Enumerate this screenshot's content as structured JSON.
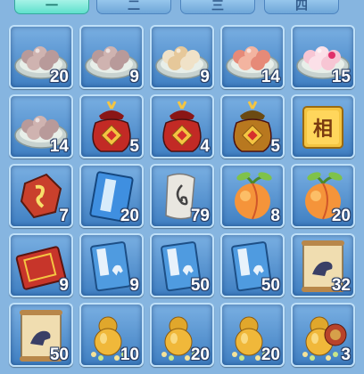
{
  "tabs": [
    {
      "label": "一",
      "active": true
    },
    {
      "label": "二",
      "active": false
    },
    {
      "label": "三",
      "active": false
    },
    {
      "label": "四",
      "active": false
    }
  ],
  "items": [
    {
      "icon": "grey-tangyuan-plate-icon",
      "count": "20"
    },
    {
      "icon": "grey-tangyuan-plate-icon",
      "count": "9"
    },
    {
      "icon": "sesame-tangyuan-plate-icon",
      "count": "9"
    },
    {
      "icon": "pink-tangyuan-plate-icon",
      "count": "14"
    },
    {
      "icon": "flower-tangyuan-plate-icon",
      "count": "15"
    },
    {
      "icon": "grey-tangyuan-plate-icon",
      "count": "14"
    },
    {
      "icon": "red-lucky-bag-icon",
      "count": "5"
    },
    {
      "icon": "red-lucky-bag-icon",
      "count": "4"
    },
    {
      "icon": "gold-lucky-bag-icon",
      "count": "5"
    },
    {
      "icon": "xiang-yellow-token-icon",
      "count": "",
      "glyph": "相"
    },
    {
      "icon": "red-rune-stone-icon",
      "count": "7"
    },
    {
      "icon": "blue-book-icon",
      "count": "20"
    },
    {
      "icon": "white-scroll-icon",
      "count": "79"
    },
    {
      "icon": "peach-icon",
      "count": "8"
    },
    {
      "icon": "peach-icon",
      "count": "20"
    },
    {
      "icon": "red-tome-icon",
      "count": "9"
    },
    {
      "icon": "blue-horse-manual-icon",
      "count": "9"
    },
    {
      "icon": "blue-horse-manual-icon",
      "count": "50"
    },
    {
      "icon": "blue-horse-manual-icon",
      "count": "50"
    },
    {
      "icon": "horse-scroll-icon",
      "count": "32"
    },
    {
      "icon": "horse-scroll-icon",
      "count": "50"
    },
    {
      "icon": "gold-gourd-coins-icon",
      "count": "10"
    },
    {
      "icon": "gold-gourd-coins-icon",
      "count": "20"
    },
    {
      "icon": "gold-gourd-coins-icon",
      "count": "20"
    },
    {
      "icon": "gourd-coin-pouch-icon",
      "count": "3"
    }
  ],
  "colors": {
    "background": "#86b5e0",
    "slot": "#4f8fd0",
    "active_tab": "#5fe0cc",
    "count_text": "#ffffff"
  }
}
